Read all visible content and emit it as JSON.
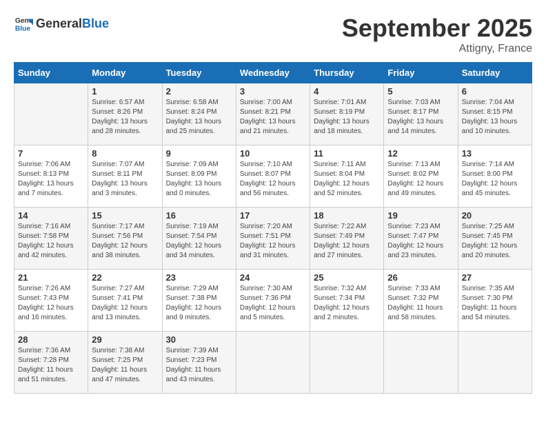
{
  "header": {
    "logo_general": "General",
    "logo_blue": "Blue",
    "month": "September 2025",
    "location": "Attigny, France"
  },
  "days_of_week": [
    "Sunday",
    "Monday",
    "Tuesday",
    "Wednesday",
    "Thursday",
    "Friday",
    "Saturday"
  ],
  "weeks": [
    [
      {
        "day": "",
        "info": ""
      },
      {
        "day": "1",
        "info": "Sunrise: 6:57 AM\nSunset: 8:26 PM\nDaylight: 13 hours\nand 28 minutes."
      },
      {
        "day": "2",
        "info": "Sunrise: 6:58 AM\nSunset: 8:24 PM\nDaylight: 13 hours\nand 25 minutes."
      },
      {
        "day": "3",
        "info": "Sunrise: 7:00 AM\nSunset: 8:21 PM\nDaylight: 13 hours\nand 21 minutes."
      },
      {
        "day": "4",
        "info": "Sunrise: 7:01 AM\nSunset: 8:19 PM\nDaylight: 13 hours\nand 18 minutes."
      },
      {
        "day": "5",
        "info": "Sunrise: 7:03 AM\nSunset: 8:17 PM\nDaylight: 13 hours\nand 14 minutes."
      },
      {
        "day": "6",
        "info": "Sunrise: 7:04 AM\nSunset: 8:15 PM\nDaylight: 13 hours\nand 10 minutes."
      }
    ],
    [
      {
        "day": "7",
        "info": "Sunrise: 7:06 AM\nSunset: 8:13 PM\nDaylight: 13 hours\nand 7 minutes."
      },
      {
        "day": "8",
        "info": "Sunrise: 7:07 AM\nSunset: 8:11 PM\nDaylight: 13 hours\nand 3 minutes."
      },
      {
        "day": "9",
        "info": "Sunrise: 7:09 AM\nSunset: 8:09 PM\nDaylight: 13 hours\nand 0 minutes."
      },
      {
        "day": "10",
        "info": "Sunrise: 7:10 AM\nSunset: 8:07 PM\nDaylight: 12 hours\nand 56 minutes."
      },
      {
        "day": "11",
        "info": "Sunrise: 7:11 AM\nSunset: 8:04 PM\nDaylight: 12 hours\nand 52 minutes."
      },
      {
        "day": "12",
        "info": "Sunrise: 7:13 AM\nSunset: 8:02 PM\nDaylight: 12 hours\nand 49 minutes."
      },
      {
        "day": "13",
        "info": "Sunrise: 7:14 AM\nSunset: 8:00 PM\nDaylight: 12 hours\nand 45 minutes."
      }
    ],
    [
      {
        "day": "14",
        "info": "Sunrise: 7:16 AM\nSunset: 7:58 PM\nDaylight: 12 hours\nand 42 minutes."
      },
      {
        "day": "15",
        "info": "Sunrise: 7:17 AM\nSunset: 7:56 PM\nDaylight: 12 hours\nand 38 minutes."
      },
      {
        "day": "16",
        "info": "Sunrise: 7:19 AM\nSunset: 7:54 PM\nDaylight: 12 hours\nand 34 minutes."
      },
      {
        "day": "17",
        "info": "Sunrise: 7:20 AM\nSunset: 7:51 PM\nDaylight: 12 hours\nand 31 minutes."
      },
      {
        "day": "18",
        "info": "Sunrise: 7:22 AM\nSunset: 7:49 PM\nDaylight: 12 hours\nand 27 minutes."
      },
      {
        "day": "19",
        "info": "Sunrise: 7:23 AM\nSunset: 7:47 PM\nDaylight: 12 hours\nand 23 minutes."
      },
      {
        "day": "20",
        "info": "Sunrise: 7:25 AM\nSunset: 7:45 PM\nDaylight: 12 hours\nand 20 minutes."
      }
    ],
    [
      {
        "day": "21",
        "info": "Sunrise: 7:26 AM\nSunset: 7:43 PM\nDaylight: 12 hours\nand 16 minutes."
      },
      {
        "day": "22",
        "info": "Sunrise: 7:27 AM\nSunset: 7:41 PM\nDaylight: 12 hours\nand 13 minutes."
      },
      {
        "day": "23",
        "info": "Sunrise: 7:29 AM\nSunset: 7:38 PM\nDaylight: 12 hours\nand 9 minutes."
      },
      {
        "day": "24",
        "info": "Sunrise: 7:30 AM\nSunset: 7:36 PM\nDaylight: 12 hours\nand 5 minutes."
      },
      {
        "day": "25",
        "info": "Sunrise: 7:32 AM\nSunset: 7:34 PM\nDaylight: 12 hours\nand 2 minutes."
      },
      {
        "day": "26",
        "info": "Sunrise: 7:33 AM\nSunset: 7:32 PM\nDaylight: 11 hours\nand 58 minutes."
      },
      {
        "day": "27",
        "info": "Sunrise: 7:35 AM\nSunset: 7:30 PM\nDaylight: 11 hours\nand 54 minutes."
      }
    ],
    [
      {
        "day": "28",
        "info": "Sunrise: 7:36 AM\nSunset: 7:28 PM\nDaylight: 11 hours\nand 51 minutes."
      },
      {
        "day": "29",
        "info": "Sunrise: 7:38 AM\nSunset: 7:25 PM\nDaylight: 11 hours\nand 47 minutes."
      },
      {
        "day": "30",
        "info": "Sunrise: 7:39 AM\nSunset: 7:23 PM\nDaylight: 11 hours\nand 43 minutes."
      },
      {
        "day": "",
        "info": ""
      },
      {
        "day": "",
        "info": ""
      },
      {
        "day": "",
        "info": ""
      },
      {
        "day": "",
        "info": ""
      }
    ]
  ]
}
